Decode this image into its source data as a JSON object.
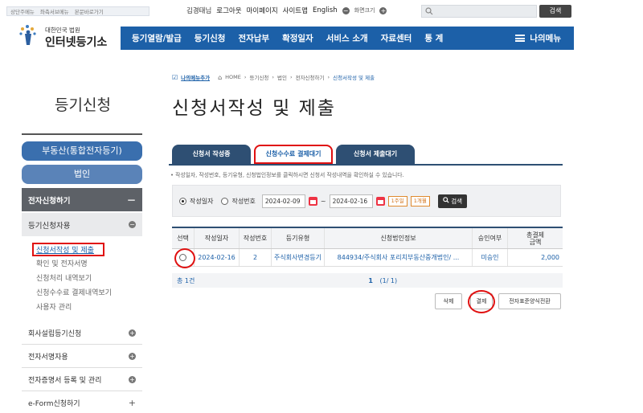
{
  "skip_links": [
    "상단주메뉴",
    "좌측서브메뉴",
    "본문바로가기"
  ],
  "util": {
    "user_name": "김경태님",
    "logout": "로그아웃",
    "mypage": "마이페이지",
    "sitemap": "사이트맵",
    "english": "English",
    "fontsize": "화면크기",
    "search_button": "검색"
  },
  "logo": {
    "small": "대한민국 법원",
    "big": "인터넷등기소"
  },
  "gnb": {
    "items": [
      "등기열람/발급",
      "등기신청",
      "전자납부",
      "확정일자",
      "서비스 소개",
      "자료센터",
      "통 계"
    ],
    "mymenu": "나의메뉴"
  },
  "breadcrumb": {
    "favorite": "나의메뉴추가",
    "path": [
      "HOME",
      "등기신청",
      "법인",
      "전자신청하기"
    ],
    "current": "신청서작성 및 제출"
  },
  "side_title": "등기신청",
  "page_title": "신청서작성 및 제출",
  "sidebar": {
    "realestate": "부동산(통합전자등기)",
    "corp": "법인",
    "e_apply": "전자신청하기",
    "e_apply_toggle": "－",
    "reg_user": "등기신청자용",
    "subs": [
      "신청서작성 및 제출",
      "확인 및 전자서명",
      "신청처리 내역보기",
      "신청수수료 결제내역보기",
      "사용자 관리"
    ],
    "items": [
      "회사설립등기신청",
      "전자서명자용",
      "전자증명서 등록 및 관리"
    ],
    "eform": "e-Form신청하기",
    "eform_toggle": "+"
  },
  "tabs": [
    "신청서 작성중",
    "신청수수료 결제대기",
    "신청서 제출대기"
  ],
  "note": "• 작성일자, 작성번호, 등기유형, 신청법인정보를 클릭하시면 신청서 작성내역을 확인하실 수 있습니다.",
  "search": {
    "opt1": "작성일자",
    "opt2": "작성번호",
    "date_from": "2024-02-09",
    "tilde": "~",
    "date_to": "2024-02-16",
    "week": "1주일",
    "month": "1개월",
    "button": "검색"
  },
  "table": {
    "headers": [
      "선택",
      "작성일자",
      "작성번호",
      "등기유형",
      "신청법인정보",
      "승인여부",
      "총결제\n금액"
    ],
    "rows": [
      {
        "date": "2024-02-16",
        "no": "2",
        "type": "주식회사변경등기",
        "info": "844934/주식회사 포리치부동산중개법인/ ...",
        "approval": "미승인",
        "amount": "2,000"
      }
    ],
    "total": "총 1건",
    "page": "1",
    "page_info": "(1/ 1)"
  },
  "actions": {
    "delete": "삭제",
    "pay": "결제",
    "convert": "전자표준양식전환"
  }
}
